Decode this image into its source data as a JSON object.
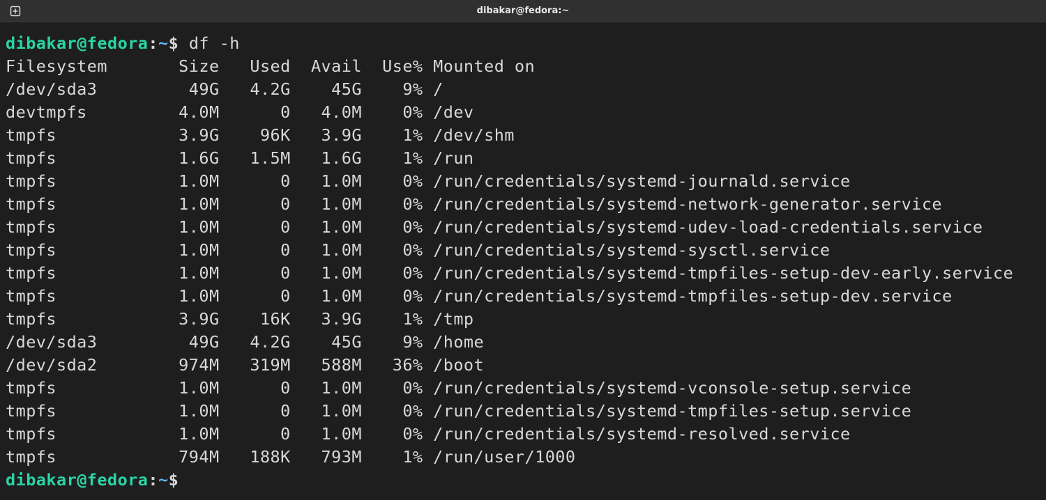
{
  "window": {
    "title": "dibakar@fedora:~"
  },
  "prompt": {
    "user": "dibakar",
    "host": "fedora",
    "cwd": "~",
    "symbol": "$"
  },
  "command": "df -h",
  "table": {
    "headers": [
      "Filesystem",
      "Size",
      "Used",
      "Avail",
      "Use%",
      "Mounted on"
    ],
    "widths": [
      15,
      6,
      6,
      6,
      5,
      0
    ],
    "rows": [
      [
        "/dev/sda3",
        "49G",
        "4.2G",
        "45G",
        "9%",
        "/"
      ],
      [
        "devtmpfs",
        "4.0M",
        "0",
        "4.0M",
        "0%",
        "/dev"
      ],
      [
        "tmpfs",
        "3.9G",
        "96K",
        "3.9G",
        "1%",
        "/dev/shm"
      ],
      [
        "tmpfs",
        "1.6G",
        "1.5M",
        "1.6G",
        "1%",
        "/run"
      ],
      [
        "tmpfs",
        "1.0M",
        "0",
        "1.0M",
        "0%",
        "/run/credentials/systemd-journald.service"
      ],
      [
        "tmpfs",
        "1.0M",
        "0",
        "1.0M",
        "0%",
        "/run/credentials/systemd-network-generator.service"
      ],
      [
        "tmpfs",
        "1.0M",
        "0",
        "1.0M",
        "0%",
        "/run/credentials/systemd-udev-load-credentials.service"
      ],
      [
        "tmpfs",
        "1.0M",
        "0",
        "1.0M",
        "0%",
        "/run/credentials/systemd-sysctl.service"
      ],
      [
        "tmpfs",
        "1.0M",
        "0",
        "1.0M",
        "0%",
        "/run/credentials/systemd-tmpfiles-setup-dev-early.service"
      ],
      [
        "tmpfs",
        "1.0M",
        "0",
        "1.0M",
        "0%",
        "/run/credentials/systemd-tmpfiles-setup-dev.service"
      ],
      [
        "tmpfs",
        "3.9G",
        "16K",
        "3.9G",
        "1%",
        "/tmp"
      ],
      [
        "/dev/sda3",
        "49G",
        "4.2G",
        "45G",
        "9%",
        "/home"
      ],
      [
        "/dev/sda2",
        "974M",
        "319M",
        "588M",
        "36%",
        "/boot"
      ],
      [
        "tmpfs",
        "1.0M",
        "0",
        "1.0M",
        "0%",
        "/run/credentials/systemd-vconsole-setup.service"
      ],
      [
        "tmpfs",
        "1.0M",
        "0",
        "1.0M",
        "0%",
        "/run/credentials/systemd-tmpfiles-setup.service"
      ],
      [
        "tmpfs",
        "1.0M",
        "0",
        "1.0M",
        "0%",
        "/run/credentials/systemd-resolved.service"
      ],
      [
        "tmpfs",
        "794M",
        "188K",
        "793M",
        "1%",
        "/run/user/1000"
      ]
    ]
  }
}
